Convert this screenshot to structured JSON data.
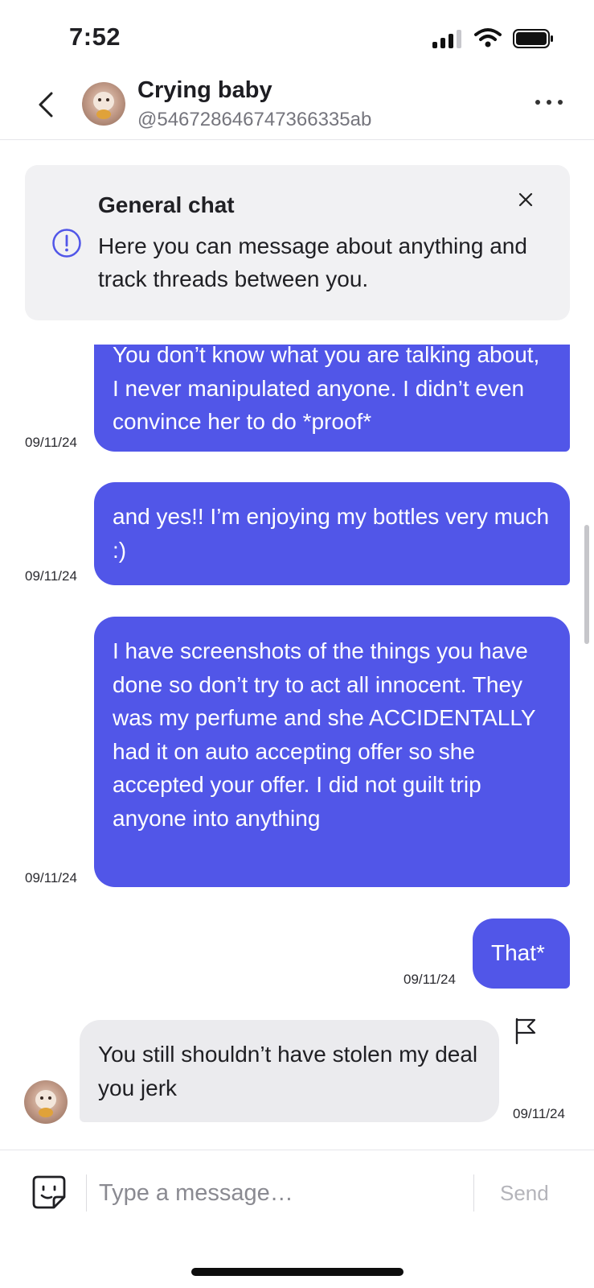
{
  "status_bar": {
    "time": "7:52",
    "icons": [
      "cellular-signal-icon",
      "wifi-icon",
      "battery-icon"
    ]
  },
  "header": {
    "back_icon": "chevron-left-icon",
    "title": "Crying baby",
    "handle": "@546728646747366335ab",
    "more_icon": "more-horizontal-icon"
  },
  "banner": {
    "title": "General chat",
    "text": "Here you can message about anything and track threads between you.",
    "info_icon": "info-circle-icon",
    "close_icon": "close-icon"
  },
  "messages": [
    {
      "direction": "outgoing",
      "text": "You don’t know what you are talking about, I never manipulated anyone. I didn’t even convince her to do *proof*",
      "date": "09/11/24"
    },
    {
      "direction": "outgoing",
      "text": "and yes!! I’m enjoying my bottles very much :)",
      "date": "09/11/24"
    },
    {
      "direction": "outgoing",
      "text": "I have screenshots of the things you have done so don’t try to act all innocent. They was my perfume and she ACCIDENTALLY had it on auto accepting offer so she accepted your offer. I did not guilt trip anyone into anything",
      "date": "09/11/24"
    },
    {
      "direction": "outgoing",
      "text": "That*",
      "date": "09/11/24"
    },
    {
      "direction": "incoming",
      "text": "You still shouldn’t have stolen my deal you jerk",
      "date": "09/11/24",
      "action_icon": "flag-icon"
    }
  ],
  "composer": {
    "sticker_icon": "sticker-icon",
    "placeholder": "Type a message…",
    "value": "",
    "send_label": "Send"
  },
  "colors": {
    "accent": "#5156e8",
    "incoming_bubble": "#ebebee",
    "banner_bg": "#f1f1f3",
    "send_disabled": "#b4b4ba"
  }
}
